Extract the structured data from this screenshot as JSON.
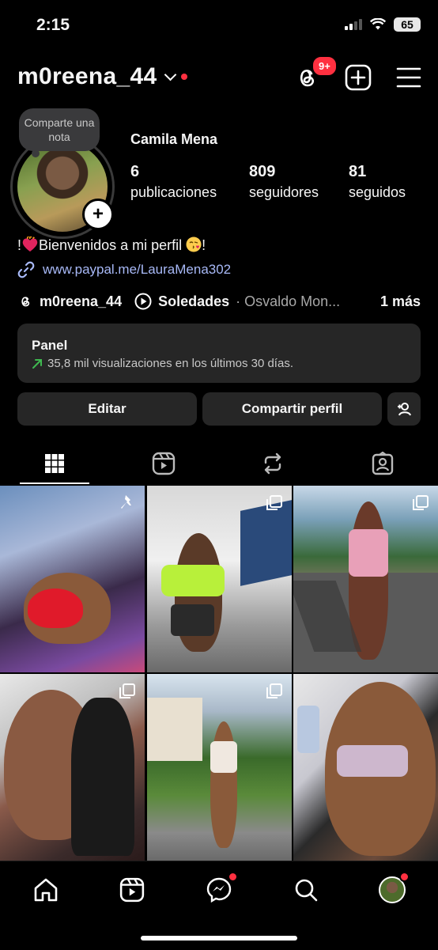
{
  "status": {
    "time": "2:15",
    "battery": "65"
  },
  "header": {
    "username": "m0reena_44",
    "threads_badge": "9+"
  },
  "profile": {
    "note": "Comparte una nota",
    "full_name": "Camila Mena",
    "stats": [
      {
        "value": "6",
        "label": "publicaciones"
      },
      {
        "value": "809",
        "label": "seguidores"
      },
      {
        "value": "81",
        "label": "seguidos"
      }
    ],
    "bio_prefix": "!",
    "bio_text": "Bienvenidos a mi perfil",
    "bio_suffix": "!",
    "link": "www.paypal.me/LauraMena302",
    "threads_handle": "m0reena_44",
    "song_title": "Soledades",
    "song_artist": "· Osvaldo Mon...",
    "more": "1 más"
  },
  "panel": {
    "title": "Panel",
    "subtitle": "35,8 mil visualizaciones en los últimos 30 días."
  },
  "buttons": {
    "edit": "Editar",
    "share": "Compartir perfil"
  },
  "tabs": [
    "grid",
    "reels",
    "reposts",
    "tagged"
  ],
  "grid_posts": [
    {
      "pinned": true,
      "multi": false
    },
    {
      "pinned": false,
      "multi": true
    },
    {
      "pinned": false,
      "multi": true
    },
    {
      "pinned": false,
      "multi": true
    },
    {
      "pinned": false,
      "multi": true
    },
    {
      "pinned": false,
      "multi": false
    }
  ],
  "colors": {
    "accent_red": "#ff3040",
    "link": "#a8b9f7",
    "surface": "#262626",
    "trend_green": "#3fb950"
  }
}
